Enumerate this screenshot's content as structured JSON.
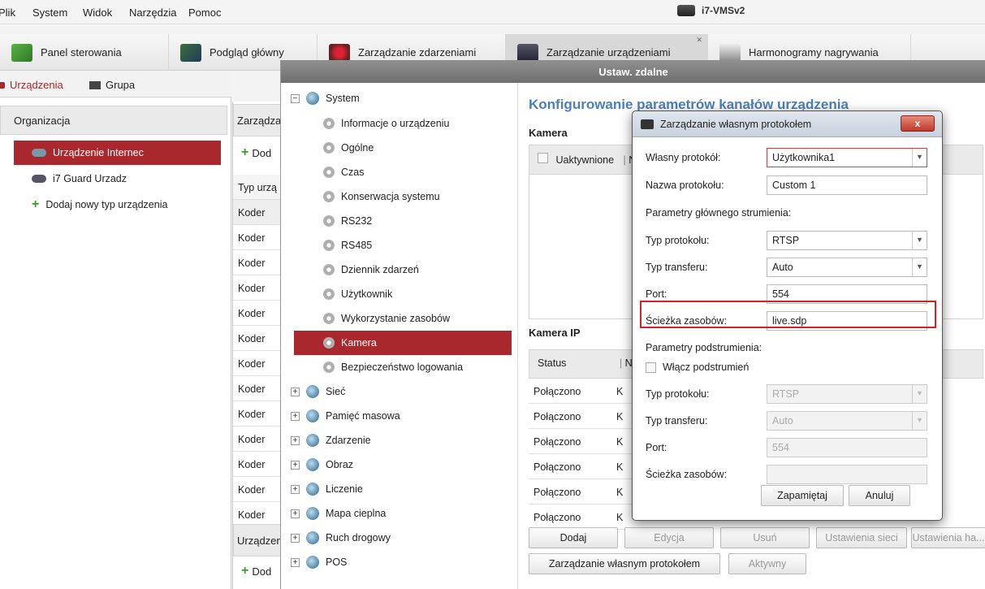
{
  "menubar": {
    "items": [
      "Plik",
      "System",
      "Widok",
      "Narzędzia",
      "Pomoc"
    ],
    "app_title": "i7-VMSv2"
  },
  "tabs": [
    {
      "label": "Panel sterowania"
    },
    {
      "label": "Podgląd główny"
    },
    {
      "label": "Zarządzanie zdarzeniami"
    },
    {
      "label": "Zarządzanie urządzeniami"
    },
    {
      "label": "Harmonogramy nagrywania"
    }
  ],
  "left_panel": {
    "tab_devices": "Urządzenia",
    "tab_group": "Grupa",
    "org_header": "Organizacja",
    "tree": [
      {
        "label": "Urządzenie Internec"
      },
      {
        "label": "i7 Guard Urzadz"
      },
      {
        "label": "Dodaj nowy typ urządzenia"
      }
    ]
  },
  "middle": {
    "header1": "Zarządza",
    "add_label": "Dod",
    "type_header": "Typ urzą",
    "header2": "Urządzen",
    "add_label2": "Dod",
    "rows": [
      "Koder",
      "Koder",
      "Koder",
      "Koder",
      "Koder",
      "Koder",
      "Koder",
      "Koder",
      "Koder",
      "Koder",
      "Koder",
      "Koder",
      "Koder"
    ]
  },
  "remote": {
    "title": "Ustaw. zdalne",
    "tree_system": "System",
    "system_children": [
      "Informacje o urządzeniu",
      "Ogólne",
      "Czas",
      "Konserwacja systemu",
      "RS232",
      "RS485",
      "Dziennik zdarzeń",
      "Użytkownik",
      "Wykorzystanie zasobów",
      "Kamera",
      "Bezpieczeństwo logowania"
    ],
    "top_level": [
      "Sieć",
      "Pamięć masowa",
      "Zdarzenie",
      "Obraz",
      "Liczenie",
      "Mapa cieplna",
      "Ruch drogowy",
      "POS"
    ],
    "config_title": "Konfigurowanie parametrów kanałów urządzenia",
    "camera_section": "Kamera",
    "enabled_label": "Uaktywnione",
    "enabled_col2": "N",
    "ip_camera_section": "Kamera IP",
    "status_header": "Status",
    "status_col2": "N",
    "status_rows": [
      "Połączono",
      "Połączono",
      "Połączono",
      "Połączono",
      "Połączono",
      "Połączono"
    ],
    "status_col2_values": [
      "K",
      "K",
      "K",
      "K",
      "K",
      "K"
    ],
    "buttons": {
      "add": "Dodaj",
      "edit": "Edycja",
      "delete": "Usuń",
      "network": "Ustawienia sieci",
      "password": "Ustawienia ha...",
      "custom_protocol": "Zarządzanie własnym protokołem",
      "active": "Aktywny"
    }
  },
  "protocol_dialog": {
    "title": "Zarządzanie własnym protokołem",
    "close": "x",
    "own_protocol_label": "Własny protokół:",
    "own_protocol_value": "Użytkownika1",
    "protocol_name_label": "Nazwa protokołu:",
    "protocol_name_value": "Custom 1",
    "main_stream_header": "Parametry głównego strumienia:",
    "protocol_type_label": "Typ protokołu:",
    "protocol_type_value": "RTSP",
    "transfer_type_label": "Typ transferu:",
    "transfer_type_value": "Auto",
    "port_label": "Port:",
    "port_value": "554",
    "resource_path_label": "Ścieżka zasobów:",
    "resource_path_value": "live.sdp",
    "substream_header": "Parametry podstrumienia:",
    "enable_substream_label": "Włącz podstrumień",
    "sub_protocol_type_label": "Typ protokołu:",
    "sub_protocol_type_value": "RTSP",
    "sub_transfer_type_label": "Typ transferu:",
    "sub_transfer_type_value": "Auto",
    "sub_port_label": "Port:",
    "sub_port_value": "554",
    "sub_resource_path_label": "Ścieżka zasobów:",
    "sub_resource_path_value": "",
    "save_button": "Zapamiętaj",
    "cancel_button": "Anuluj"
  },
  "colors": {
    "accent_red": "#a9282d",
    "title_blue": "#4a7fbf",
    "highlight_red": "#d42027"
  }
}
